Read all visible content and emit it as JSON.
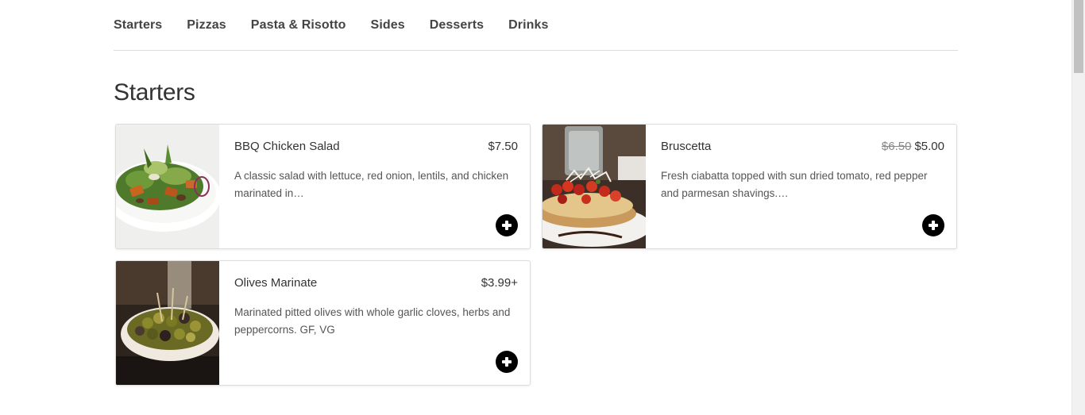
{
  "nav": {
    "categories": [
      "Starters",
      "Pizzas",
      "Pasta & Risotto",
      "Sides",
      "Desserts",
      "Drinks"
    ]
  },
  "section": {
    "title": "Starters"
  },
  "items": [
    {
      "name": "BBQ Chicken Salad",
      "price": "$7.50",
      "description": "A classic salad with lettuce, red onion, lentils, and chicken marinated in…",
      "image": "salad-photo"
    },
    {
      "name": "Bruscetta",
      "price_old": "$6.50",
      "price": "$5.00",
      "description": "Fresh ciabatta topped with sun dried tomato, red pepper and parmesan shavings.…",
      "image": "bruschetta-photo"
    },
    {
      "name": "Olives Marinate",
      "price": "$3.99+",
      "description": "Marinated pitted olives with whole garlic cloves, herbs and peppercorns. GF, VG",
      "image": "olives-photo"
    }
  ],
  "icons": {
    "add": "plus-circle-icon"
  },
  "colors": {
    "add_button": "#000000",
    "text": "#333333",
    "divider": "#dcdcdc"
  }
}
